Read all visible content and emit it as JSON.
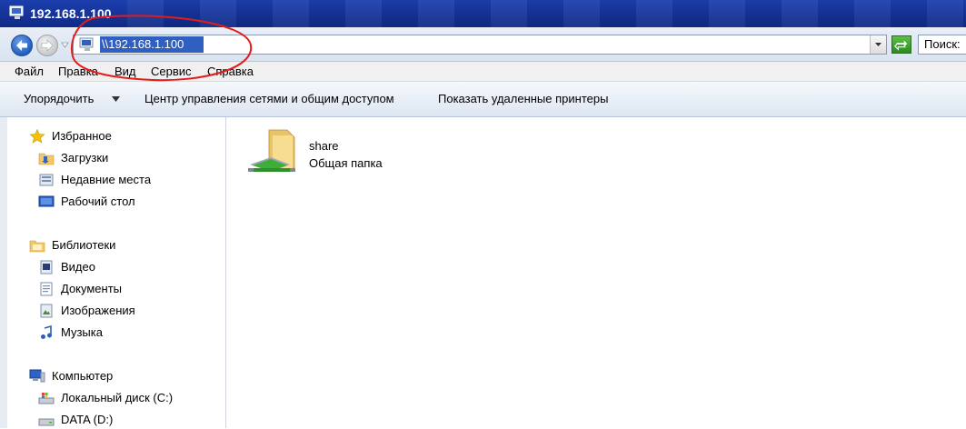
{
  "window": {
    "title": "192.168.1.100"
  },
  "address": {
    "path": "\\\\192.168.1.100"
  },
  "search": {
    "placeholder": "Поиск:"
  },
  "menu": [
    "Файл",
    "Правка",
    "Вид",
    "Сервис",
    "Справка"
  ],
  "commands": {
    "organize": "Упорядочить",
    "network_center": "Центр управления сетями и общим доступом",
    "show_printers": "Показать удаленные принтеры"
  },
  "nav": {
    "favorites": "Избранное",
    "downloads": "Загрузки",
    "recent": "Недавние места",
    "desktop": "Рабочий стол",
    "libraries": "Библиотеки",
    "video": "Видео",
    "documents": "Документы",
    "pictures": "Изображения",
    "music": "Музыка",
    "computer": "Компьютер",
    "local_disk": "Локальный диск (C:)",
    "data_disk": "DATA (D:)"
  },
  "items": [
    {
      "name": "share",
      "type": "Общая папка"
    }
  ],
  "colors": {
    "accent": "#2f5fc0",
    "titlebar": "#1b3fae",
    "annotation": "#e31b1b"
  }
}
